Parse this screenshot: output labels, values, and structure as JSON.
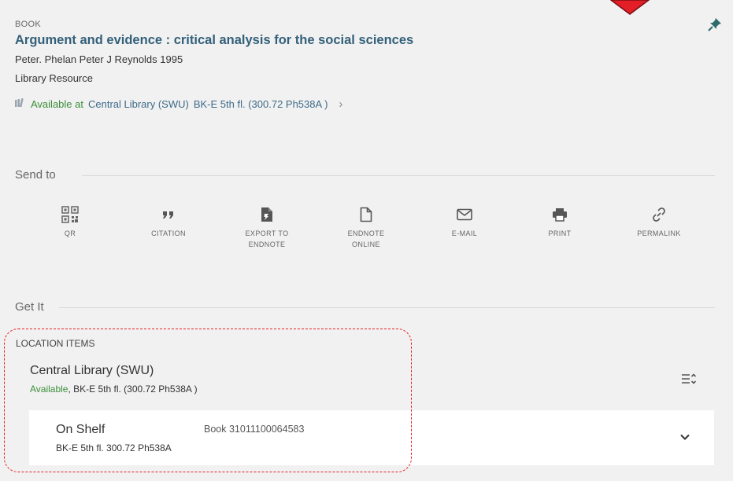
{
  "record": {
    "type": "BOOK",
    "title": "Argument and evidence : critical analysis for the social sciences",
    "author": "Peter. Phelan Peter J Reynolds 1995",
    "resource_type": "Library Resource",
    "availability": {
      "status": "Available at",
      "location": "Central Library (SWU)",
      "shelf": "BK-E 5th fl. (300.72 Ph538A )"
    }
  },
  "send_to": {
    "label": "Send to",
    "actions": [
      {
        "label_1": "QR",
        "label_2": ""
      },
      {
        "label_1": "CITATION",
        "label_2": ""
      },
      {
        "label_1": "EXPORT TO",
        "label_2": "ENDNOTE"
      },
      {
        "label_1": "ENDNOTE",
        "label_2": "ONLINE"
      },
      {
        "label_1": "E-MAIL",
        "label_2": ""
      },
      {
        "label_1": "PRINT",
        "label_2": ""
      },
      {
        "label_1": "PERMALINK",
        "label_2": ""
      }
    ]
  },
  "get_it": {
    "label": "Get It",
    "location_items_heading": "LOCATION ITEMS",
    "location": {
      "name": "Central Library (SWU)",
      "status": "Available",
      "detail": ", BK-E 5th fl. (300.72 Ph538A )"
    },
    "item": {
      "status": "On Shelf",
      "call_number": "BK-E 5th fl. 300.72 Ph538A",
      "barcode": "Book 31011100064583"
    }
  },
  "colors": {
    "title": "#33607a",
    "available": "#3c8f3a",
    "link": "#3d6b89",
    "highlight": "#e41e26",
    "marker": "#e41e26",
    "pin": "#2f6b6b"
  }
}
